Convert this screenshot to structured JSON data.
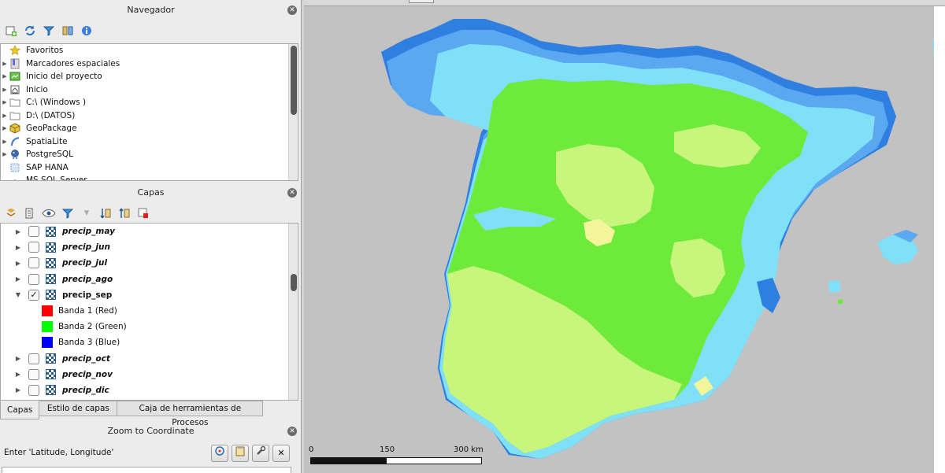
{
  "navigator": {
    "title": "Navegador",
    "items": [
      {
        "label": "Favoritos",
        "icon": "star-icon",
        "has_arrow": false
      },
      {
        "label": "Marcadores espaciales",
        "icon": "bookmark-icon",
        "has_arrow": true
      },
      {
        "label": "Inicio del proyecto",
        "icon": "project-home-icon",
        "has_arrow": true
      },
      {
        "label": "Inicio",
        "icon": "home-icon",
        "has_arrow": true
      },
      {
        "label": "C:\\ (Windows )",
        "icon": "folder-icon",
        "has_arrow": true
      },
      {
        "label": "D:\\ (DATOS)",
        "icon": "folder-icon",
        "has_arrow": true
      },
      {
        "label": "GeoPackage",
        "icon": "geopackage-icon",
        "has_arrow": true
      },
      {
        "label": "SpatiaLite",
        "icon": "spatialite-icon",
        "has_arrow": true
      },
      {
        "label": "PostgreSQL",
        "icon": "postgresql-icon",
        "has_arrow": true
      },
      {
        "label": "SAP HANA",
        "icon": "sap-hana-icon",
        "has_arrow": false
      },
      {
        "label": "MS SQL Server",
        "icon": "mssql-icon",
        "has_arrow": false
      }
    ]
  },
  "layers": {
    "title": "Capas",
    "rows": [
      {
        "name": "precip_may",
        "checked": false,
        "expanded": false
      },
      {
        "name": "precip_jun",
        "checked": false,
        "expanded": false
      },
      {
        "name": "precip_jul",
        "checked": false,
        "expanded": false
      },
      {
        "name": "precip_ago",
        "checked": false,
        "expanded": false
      },
      {
        "name": "precip_sep",
        "checked": true,
        "expanded": true
      },
      {
        "name": "precip_oct",
        "checked": false,
        "expanded": false
      },
      {
        "name": "precip_nov",
        "checked": false,
        "expanded": false
      },
      {
        "name": "precip_dic",
        "checked": false,
        "expanded": false
      }
    ],
    "bands": [
      {
        "label": "Banda 1 (Red)",
        "color": "#ff0000"
      },
      {
        "label": "Banda 2 (Green)",
        "color": "#00ff00"
      },
      {
        "label": "Banda 3 (Blue)",
        "color": "#0000ff"
      }
    ]
  },
  "tabs": [
    "Capas",
    "Estilo de capas",
    "Caja de herramientas de Procesos"
  ],
  "zoom_panel": {
    "title": "Zoom to Coordinate",
    "hint": "Enter 'Latitude, Longitude'"
  },
  "scalebar": {
    "labels": [
      "0",
      "150",
      "300 km"
    ]
  },
  "map_colors": {
    "background": "#c2c2c2",
    "dark_blue": "#2f7fe0",
    "mid_blue": "#5aa8f0",
    "light_blue": "#7fe0f8",
    "green": "#6eea3a",
    "light_green": "#c8f57c",
    "yellow": "#f2f59a"
  }
}
